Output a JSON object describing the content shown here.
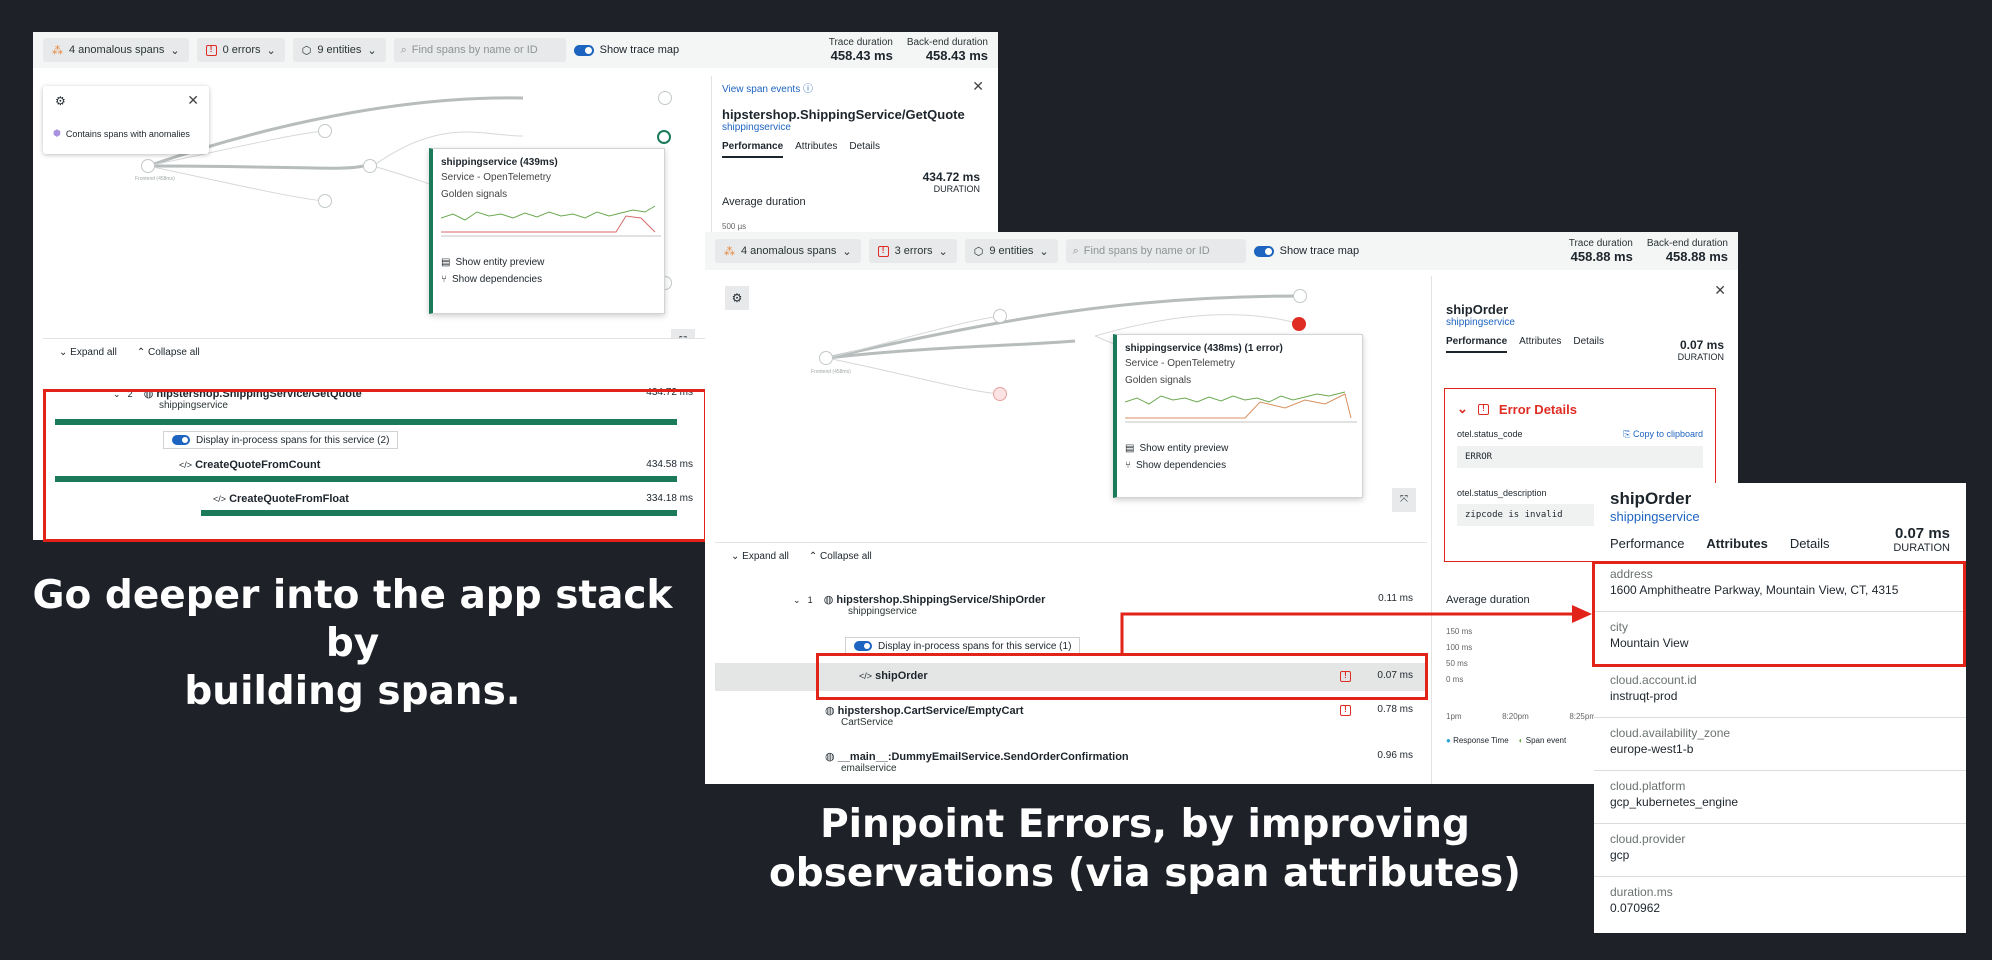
{
  "screen1": {
    "toolbar": {
      "anomalous": "4 anomalous spans",
      "errors": "0 errors",
      "entities": "9 entities",
      "search_placeholder": "Find spans by name or ID",
      "trace_map": "Show trace map",
      "trace_duration_label": "Trace duration",
      "trace_duration": "458.43 ms",
      "backend_label": "Back-end duration",
      "backend_duration": "458.43 ms"
    },
    "legend": {
      "text": "Contains spans with anomalies"
    },
    "tooltip": {
      "title": "shippingservice (439ms)",
      "subtitle": "Service - OpenTelemetry",
      "golden": "Golden signals",
      "preview": "Show entity preview",
      "deps": "Show dependencies"
    },
    "span_controls": {
      "expand": "Expand all",
      "collapse": "Collapse all"
    },
    "spans": [
      {
        "count": "2",
        "name": "hipstershop.ShippingService/GetQuote",
        "service": "shippingservice",
        "duration": "434.72 ms"
      },
      {
        "name": "CreateQuoteFromCount",
        "duration": "434.58 ms"
      },
      {
        "name": "CreateQuoteFromFloat",
        "duration": "334.18 ms"
      }
    ],
    "inprocess": "Display in-process spans for this service (2)",
    "detail": {
      "view_events": "View span events",
      "title": "hipstershop.ShippingService/GetQuote",
      "service": "shippingservice",
      "tabs": [
        "Performance",
        "Attributes",
        "Details"
      ],
      "duration": "434.72 ms",
      "duration_label": "DURATION",
      "avg_label": "Average duration",
      "axis": "500 µs"
    }
  },
  "screen2": {
    "toolbar": {
      "anomalous": "4 anomalous spans",
      "errors": "3 errors",
      "entities": "9 entities",
      "search_placeholder": "Find spans by name or ID",
      "trace_map": "Show trace map",
      "trace_duration_label": "Trace duration",
      "trace_duration": "458.88 ms",
      "backend_label": "Back-end duration",
      "backend_duration": "458.88 ms"
    },
    "tooltip": {
      "title": "shippingservice (438ms) (1 error)",
      "subtitle": "Service - OpenTelemetry",
      "golden": "Golden signals",
      "preview": "Show entity preview",
      "deps": "Show dependencies"
    },
    "span_controls": {
      "expand": "Expand all",
      "collapse": "Collapse all"
    },
    "spans": [
      {
        "count": "1",
        "name": "hipstershop.ShippingService/ShipOrder",
        "service": "shippingservice",
        "duration": "0.11 ms"
      },
      {
        "name": "shipOrder",
        "duration": "0.07 ms"
      },
      {
        "name": "hipstershop.CartService/EmptyCart",
        "service": "CartService",
        "duration": "0.78 ms"
      },
      {
        "name": "__main__:DummyEmailService.SendOrderConfirmation",
        "service": "emailservice",
        "duration": "0.96 ms"
      }
    ],
    "inprocess": "Display in-process spans for this service (1)",
    "detail": {
      "title": "shipOrder",
      "service": "shippingservice",
      "tabs": [
        "Performance",
        "Attributes",
        "Details"
      ],
      "duration": "0.07 ms",
      "duration_label": "DURATION",
      "error_title": "Error Details",
      "status_code_key": "otel.status_code",
      "copy": "Copy to clipboard",
      "status_code_val": "ERROR",
      "status_desc_key": "otel.status_description",
      "status_desc_val": "zipcode is invalid",
      "avg_label": "Average duration",
      "yticks": [
        "150 ms",
        "100 ms",
        "50 ms",
        "0 ms"
      ],
      "xticks": [
        "1pm",
        "8:20pm",
        "8:25pm"
      ],
      "legend_rt": "Response Time",
      "legend_se": "Span event"
    }
  },
  "attributes_panel": {
    "title": "shipOrder",
    "service": "shippingservice",
    "tabs": [
      "Performance",
      "Attributes",
      "Details"
    ],
    "duration": "0.07 ms",
    "duration_label": "DURATION",
    "items": [
      {
        "key": "address",
        "value": "1600 Amphitheatre Parkway, Mountain View, CT, 4315"
      },
      {
        "key": "city",
        "value": "Mountain View"
      },
      {
        "key": "cloud.account.id",
        "value": "instruqt-prod"
      },
      {
        "key": "cloud.availability_zone",
        "value": "europe-west1-b"
      },
      {
        "key": "cloud.platform",
        "value": "gcp_kubernetes_engine"
      },
      {
        "key": "cloud.provider",
        "value": "gcp"
      },
      {
        "key": "duration.ms",
        "value": "0.070962"
      }
    ]
  },
  "captions": {
    "left_line1": "Go deeper into the app stack by",
    "left_line2": "building spans.",
    "right_line1": "Pinpoint Errors, by improving",
    "right_line2": "observations (via span attributes)"
  },
  "colors": {
    "background": "#1e2128",
    "highlight": "#e2231a",
    "bar": "#1b7a5a",
    "link": "#1d64c0"
  }
}
